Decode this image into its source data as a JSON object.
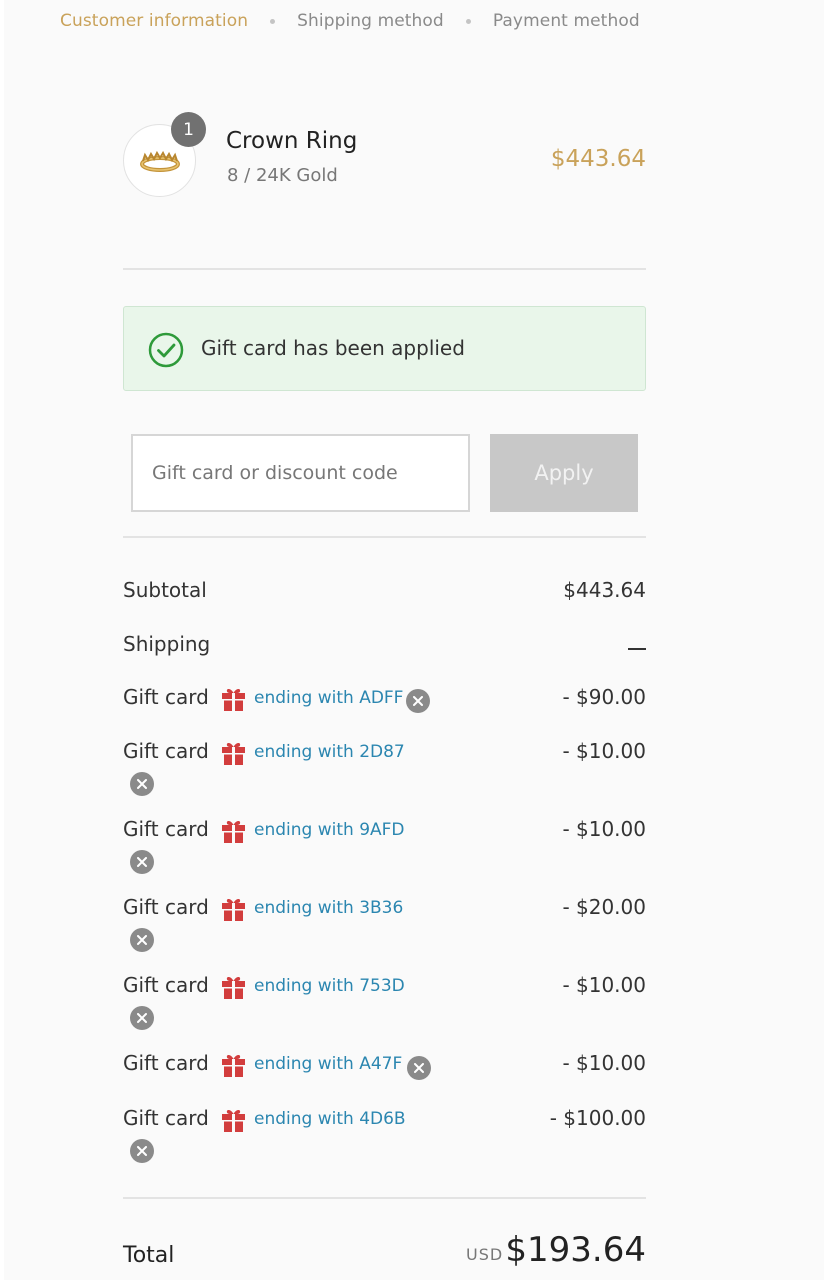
{
  "breadcrumb": [
    {
      "label": "Customer information",
      "active": true
    },
    {
      "label": "Shipping method",
      "active": false
    },
    {
      "label": "Payment method",
      "active": false
    }
  ],
  "product": {
    "quantity": "1",
    "name": "Crown Ring",
    "variant": "8 / 24K Gold",
    "price": "$443.64"
  },
  "notice": {
    "text": "Gift card has been applied"
  },
  "discount": {
    "placeholder": "Gift card or discount code",
    "apply_label": "Apply"
  },
  "summary": {
    "subtotal_label": "Subtotal",
    "subtotal_value": "$443.64",
    "shipping_label": "Shipping",
    "gift_cards": [
      {
        "label": "Gift card",
        "code": "ending with ADFF",
        "amount": "- $90.00"
      },
      {
        "label": "Gift card",
        "code": "ending with 2D87",
        "amount": "- $10.00"
      },
      {
        "label": "Gift card",
        "code": "ending with 9AFD",
        "amount": "- $10.00"
      },
      {
        "label": "Gift card",
        "code": "ending with 3B36",
        "amount": "- $20.00"
      },
      {
        "label": "Gift card",
        "code": "ending with 753D",
        "amount": "- $10.00"
      },
      {
        "label": "Gift card",
        "code": "ending with A47F",
        "amount": "- $10.00"
      },
      {
        "label": "Gift card",
        "code": "ending with 4D6B",
        "amount": "- $100.00"
      }
    ]
  },
  "total": {
    "label": "Total",
    "currency": "USD",
    "amount": "$193.64"
  },
  "colors": {
    "accent_gold": "#c9a25a",
    "link_blue": "#2b86b0",
    "gift_red": "#d23d3d",
    "success_green": "#2e9a3a"
  }
}
